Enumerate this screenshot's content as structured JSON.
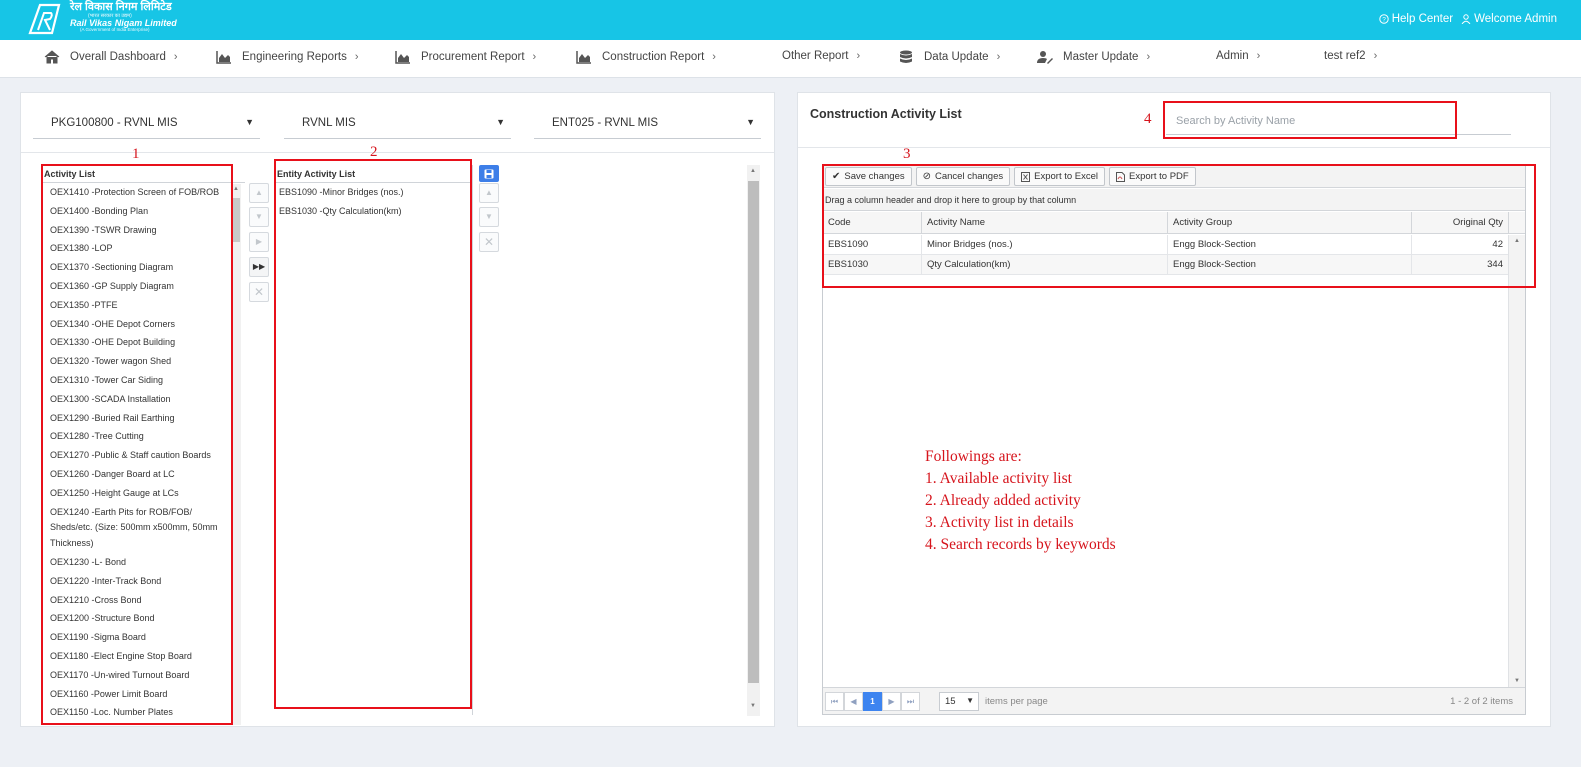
{
  "header": {
    "brand_hindi": "रेल विकास निगम लिमिटेड",
    "brand_hindi_sub": "(भारत सरकार का उद्यम)",
    "brand_english": "Rail Vikas Nigam Limited",
    "brand_english_sub": "(A Government of India Enterprise)",
    "help": "Help Center",
    "welcome": "Welcome Admin",
    "bg_color": "#17c5e6"
  },
  "nav": {
    "items": [
      {
        "label": "Overall Dashboard",
        "icon": "home-icon"
      },
      {
        "label": "Engineering Reports",
        "icon": "area-chart-icon"
      },
      {
        "label": "Procurement Report",
        "icon": "area-chart-icon"
      },
      {
        "label": "Construction Report",
        "icon": "area-chart-icon"
      },
      {
        "label": "Other Report",
        "icon": ""
      },
      {
        "label": "Data Update",
        "icon": "database-icon"
      },
      {
        "label": "Master Update",
        "icon": "user-edit-icon"
      },
      {
        "label": "Admin",
        "icon": ""
      },
      {
        "label": "test ref2",
        "icon": ""
      }
    ]
  },
  "left": {
    "dropdowns": [
      "PKG100800 - RVNL MIS",
      "RVNL MIS",
      "ENT025 - RVNL MIS"
    ],
    "activity_list": {
      "header": "Activity List",
      "items": [
        "OEX1410 -Protection Screen of FOB/ROB",
        "OEX1400 -Bonding Plan",
        "OEX1390 -TSWR Drawing",
        "OEX1380 -LOP",
        "OEX1370 -Sectioning Diagram",
        "OEX1360 -GP Supply Diagram",
        "OEX1350 -PTFE",
        "OEX1340 -OHE Depot Corners",
        "OEX1330 -OHE Depot Building",
        "OEX1320 -Tower wagon Shed",
        "OEX1310 -Tower Car Siding",
        "OEX1300 -SCADA Installation",
        "OEX1290 -Buried Rail Earthing",
        "OEX1280 -Tree Cutting",
        "OEX1270 -Public & Staff caution Boards",
        "OEX1260 -Danger Board at LC",
        "OEX1250 -Height Gauge at LCs",
        "OEX1240 -Earth Pits for ROB/FOB/ Sheds/etc. (Size: 500mm x500mm, 50mm Thickness)",
        "OEX1230 -L- Bond",
        "OEX1220 -Inter-Track Bond",
        "OEX1210 -Cross Bond",
        "OEX1200 -Structure Bond",
        "OEX1190 -Sigma Board",
        "OEX1180 -Elect Engine Stop Board",
        "OEX1170 -Un-wired Turnout Board",
        "OEX1160 -Power Limit Board",
        "OEX1150 -Loc. Number Plates"
      ]
    },
    "entity_list": {
      "header": "Entity Activity List",
      "items": [
        "EBS1090 -Minor Bridges (nos.)",
        "EBS1030 -Qty Calculation(km)"
      ]
    }
  },
  "right": {
    "title": "Construction Activity List",
    "search_placeholder": "Search by Activity Name",
    "toolbar": {
      "save": "Save changes",
      "cancel": "Cancel changes",
      "excel": "Export to Excel",
      "pdf": "Export to PDF"
    },
    "grouping_hint": "Drag a column header and drop it here to group by that column",
    "columns": [
      "Code",
      "Activity Name",
      "Activity Group",
      "Original Qty"
    ],
    "rows": [
      [
        "EBS1090",
        "Minor Bridges (nos.)",
        "Engg Block-Section",
        "42"
      ],
      [
        "EBS1030",
        "Qty Calculation(km)",
        "Engg Block-Section",
        "344"
      ]
    ],
    "pager": {
      "current_page": "1",
      "page_size": "15",
      "per_page_label": "items per page",
      "info": "1 - 2 of 2 items"
    }
  },
  "annotations": {
    "num1": "1",
    "num2": "2",
    "num3": "3",
    "num4": "4",
    "lines": [
      "Followings are:",
      "1. Available activity list",
      "2. Already added activity",
      "3. Activity list in details",
      "4. Search records by keywords"
    ],
    "color": "#e8101a"
  }
}
